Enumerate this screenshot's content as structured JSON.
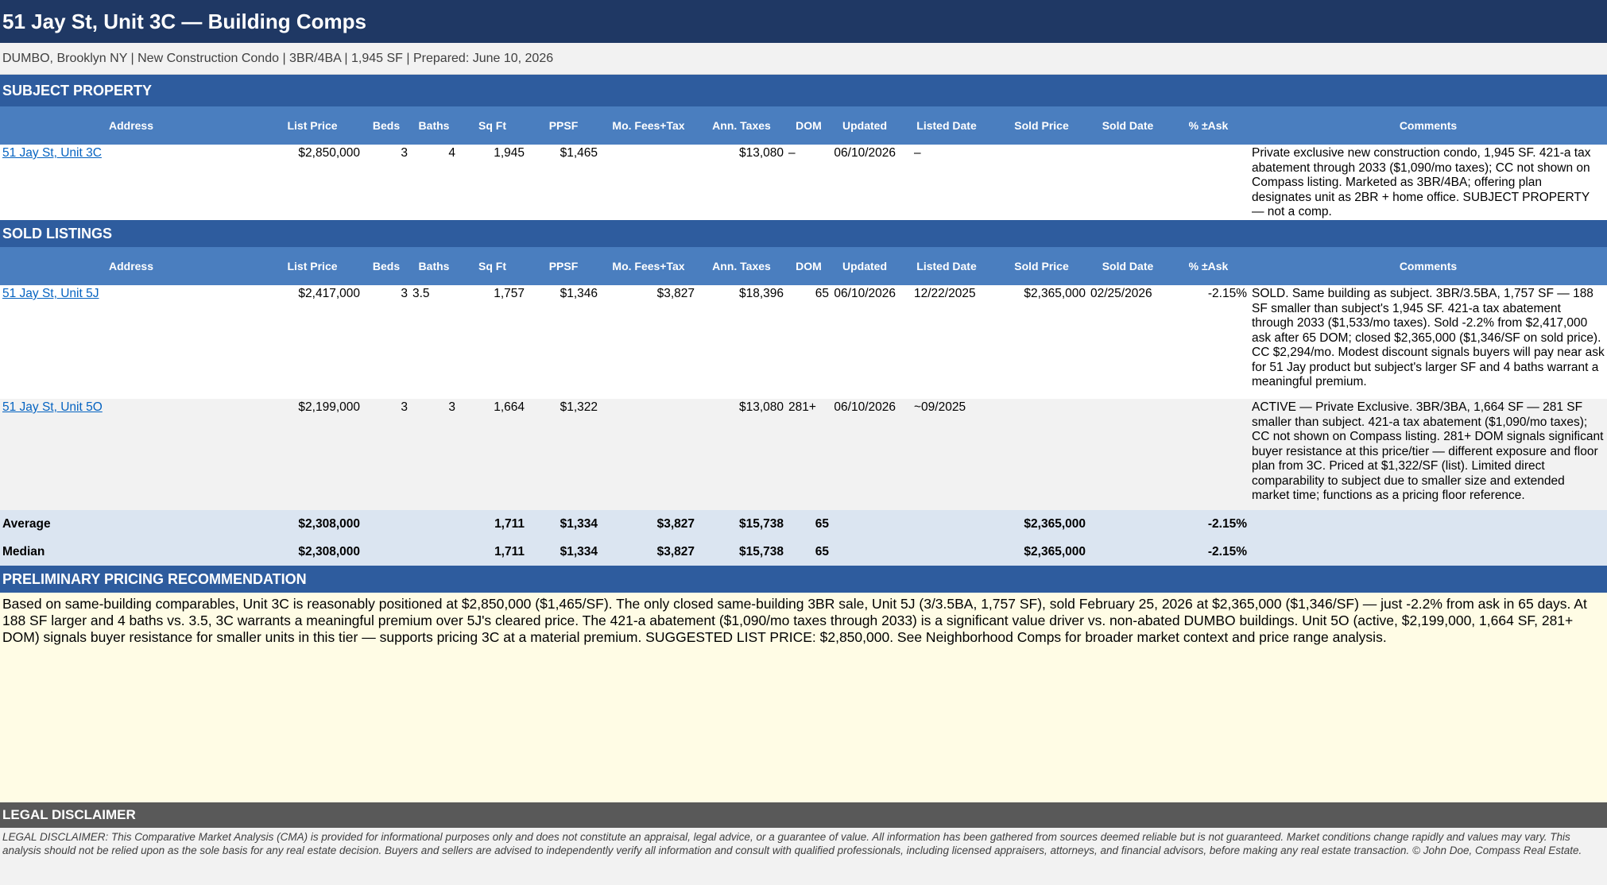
{
  "title": "51 Jay St, Unit 3C — Building Comps",
  "subtitle": "DUMBO, Brooklyn NY  |  New Construction Condo  |  3BR/4BA  |  1,945 SF  |  Prepared: June 10, 2026",
  "columns": {
    "address": "Address",
    "list_price": "List Price",
    "beds": "Beds",
    "baths": "Baths",
    "sqft": "Sq Ft",
    "ppsf": "PPSF",
    "fees": "Mo. Fees+Tax",
    "taxes": "Ann. Taxes",
    "dom": "DOM",
    "updated": "Updated",
    "listed": "Listed Date",
    "sold_price": "Sold Price",
    "sold_date": "Sold Date",
    "pct": "% ±Ask",
    "comments": "Comments"
  },
  "subject": {
    "header": "SUBJECT PROPERTY",
    "row": {
      "address": "51 Jay St, Unit 3C",
      "list_price": "$2,850,000",
      "beds": "3",
      "baths": "4",
      "sqft": "1,945",
      "ppsf": "$1,465",
      "fees": "",
      "taxes": "$13,080",
      "dom": "–",
      "updated": "06/10/2026",
      "listed": "–",
      "sold_price": "",
      "sold_date": "",
      "pct": "",
      "comments": "Private exclusive new construction condo, 1,945 SF. 421-a tax abatement through 2033 ($1,090/mo taxes); CC not shown on Compass listing. Marketed as 3BR/4BA; offering plan designates unit as 2BR + home office. SUBJECT PROPERTY — not a comp."
    }
  },
  "sold": {
    "header": "SOLD LISTINGS",
    "rows": [
      {
        "address": "51 Jay St, Unit 5J",
        "list_price": "$2,417,000",
        "beds": "3",
        "baths": "3.5",
        "sqft": "1,757",
        "ppsf": "$1,346",
        "fees": "$3,827",
        "taxes": "$18,396",
        "dom": "65",
        "updated": "06/10/2026",
        "listed": "12/22/2025",
        "sold_price": "$2,365,000",
        "sold_date": "02/25/2026",
        "pct": "-2.15%",
        "comments": "SOLD. Same building as subject. 3BR/3.5BA, 1,757 SF — 188 SF smaller than subject's 1,945 SF. 421-a tax abatement through 2033 ($1,533/mo taxes). Sold -2.2% from $2,417,000 ask after 65 DOM; closed $2,365,000 ($1,346/SF on sold price). CC $2,294/mo. Modest discount signals buyers will pay near ask for 51 Jay product but subject's larger SF and 4 baths warrant a meaningful premium."
      },
      {
        "address": "51 Jay St, Unit 5O",
        "list_price": "$2,199,000",
        "beds": "3",
        "baths": "3",
        "sqft": "1,664",
        "ppsf": "$1,322",
        "fees": "",
        "taxes": "$13,080",
        "dom": "281+",
        "updated": "06/10/2026",
        "listed": "~09/2025",
        "sold_price": "",
        "sold_date": "",
        "pct": "",
        "comments": "ACTIVE — Private Exclusive. 3BR/3BA, 1,664 SF — 281 SF smaller than subject. 421-a tax abatement ($1,090/mo taxes); CC not shown on Compass listing. 281+ DOM signals significant buyer resistance at this price/tier — different exposure and floor plan from 3C. Priced at $1,322/SF (list). Limited direct comparability to subject due to smaller size and extended market time; functions as a pricing floor reference."
      }
    ],
    "stats": [
      {
        "label": "Average",
        "list_price": "$2,308,000",
        "sqft": "1,711",
        "ppsf": "$1,334",
        "fees": "$3,827",
        "taxes": "$15,738",
        "dom": "65",
        "sold_price": "$2,365,000",
        "pct": "-2.15%"
      },
      {
        "label": "Median",
        "list_price": "$2,308,000",
        "sqft": "1,711",
        "ppsf": "$1,334",
        "fees": "$3,827",
        "taxes": "$15,738",
        "dom": "65",
        "sold_price": "$2,365,000",
        "pct": "-2.15%"
      }
    ]
  },
  "recommendation": {
    "header": "PRELIMINARY PRICING RECOMMENDATION",
    "text": "Based on same-building comparables, Unit 3C is reasonably positioned at $2,850,000 ($1,465/SF). The only closed same-building 3BR sale, Unit 5J (3/3.5BA, 1,757 SF), sold February 25, 2026 at $2,365,000 ($1,346/SF) — just -2.2% from ask in 65 days. At 188 SF larger and 4 baths vs. 3.5, 3C warrants a meaningful premium over 5J's cleared price. The 421-a abatement ($1,090/mo taxes through 2033) is a significant value driver vs. non-abated DUMBO buildings. Unit 5O (active, $2,199,000, 1,664 SF, 281+ DOM) signals buyer resistance for smaller units in this tier — supports pricing 3C at a material premium. SUGGESTED LIST PRICE: $2,850,000. See Neighborhood Comps for broader market context and price range analysis."
  },
  "legal": {
    "header": "LEGAL DISCLAIMER",
    "text": "LEGAL DISCLAIMER: This Comparative Market Analysis (CMA) is provided for informational purposes only and does not constitute an appraisal, legal advice, or a guarantee of value. All information has been gathered from sources deemed reliable but is not guaranteed. Market conditions change rapidly and values may vary. This analysis should not be relied upon as the sole basis for any real estate decision. Buyers and sellers are advised to independently verify all information and consult with qualified professionals, including licensed appraisers, attorneys, and financial advisors, before making any real estate transaction. © John Doe, Compass Real Estate."
  }
}
